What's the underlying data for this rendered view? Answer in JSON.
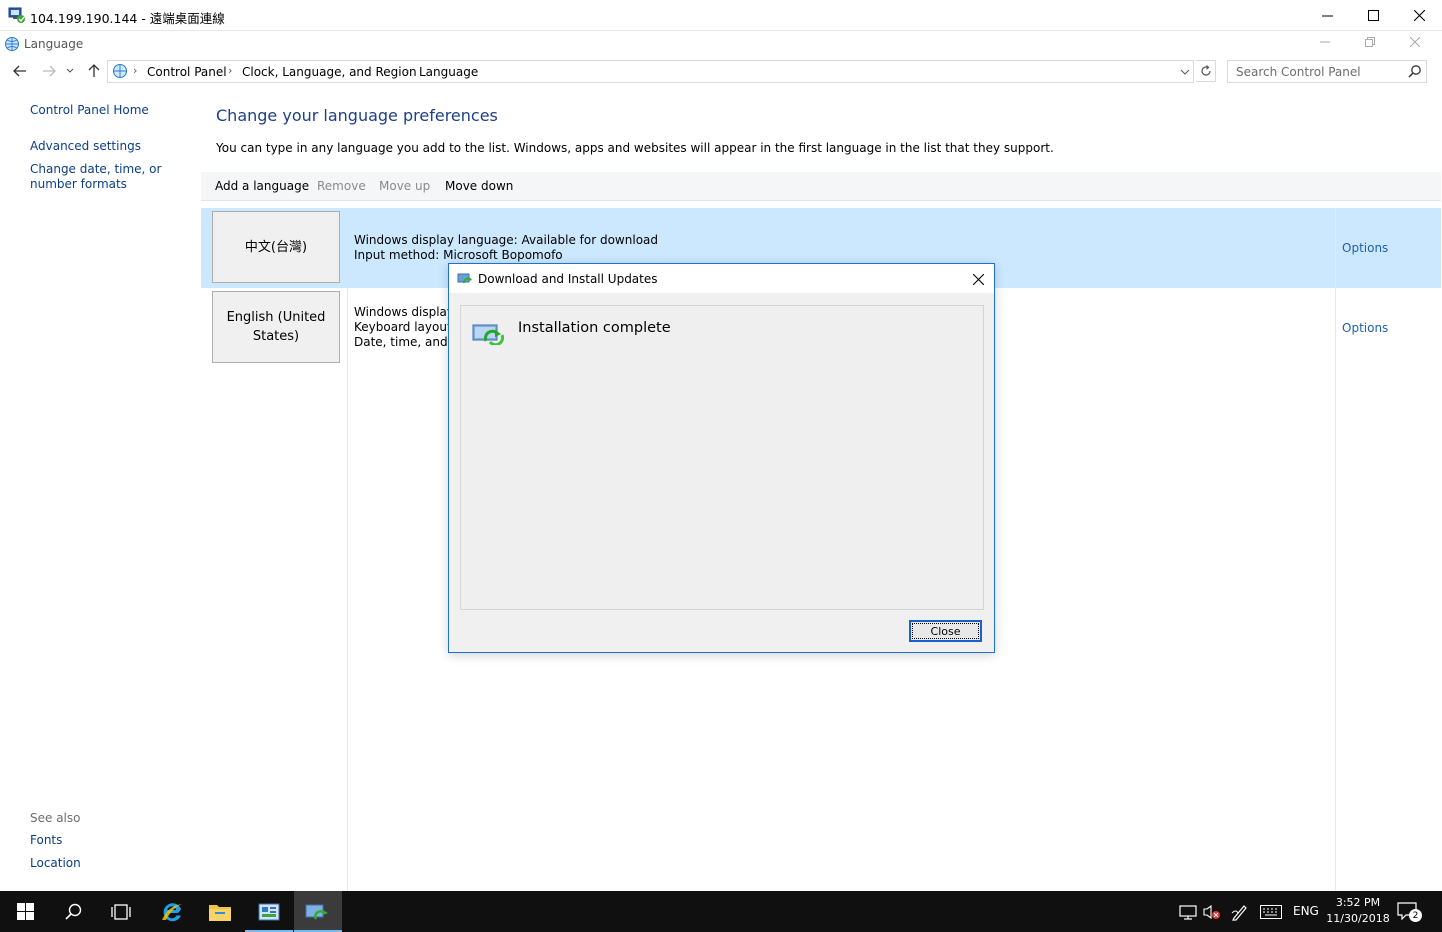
{
  "rdp_window": {
    "title": "104.199.190.144 - 遠端桌面連線",
    "minimize_icon": "minimize-icon",
    "maximize_icon": "maximize-icon",
    "close_icon": "close-icon"
  },
  "inner_window": {
    "title": "Language"
  },
  "address_bar": {
    "breadcrumbs": [
      "Control Panel",
      "Clock, Language, and Region",
      "Language"
    ],
    "search_placeholder": "Search Control Panel"
  },
  "left_nav": {
    "links": [
      "Control Panel Home",
      "Advanced settings",
      "Change date, time, or number formats"
    ],
    "see_also_label": "See also",
    "see_also_links": [
      "Fonts",
      "Location"
    ]
  },
  "main": {
    "title": "Change your language preferences",
    "description": "You can type in any language you add to the list. Windows, apps and websites will appear in the first language in the list that they support.",
    "toolbar": {
      "add": "Add a language",
      "remove": "Remove",
      "move_up": "Move up",
      "move_down": "Move down"
    },
    "languages": [
      {
        "name": "中文(台灣)",
        "line1": "Windows display language: Available for download",
        "line2": "Input method: Microsoft Bopomofo",
        "line3": "",
        "options": "Options",
        "selected": true
      },
      {
        "name": "English (United States)",
        "line1": "Windows display l",
        "line2": "Keyboard layout: U",
        "line3": "Date, time, and nu",
        "options": "Options",
        "selected": false
      }
    ]
  },
  "dialog": {
    "title": "Download and Install Updates",
    "status": "Installation complete",
    "close_button": "Close"
  },
  "taskbar": {
    "language": "ENG",
    "time": "3:52 PM",
    "date": "11/30/2018",
    "notification_count": "2"
  },
  "colors": {
    "link": "#0b3e8a",
    "title_blue": "#1e3f8a",
    "selected_row": "#cce8ff",
    "taskbar": "#101010",
    "accent": "#1a5fd0"
  }
}
